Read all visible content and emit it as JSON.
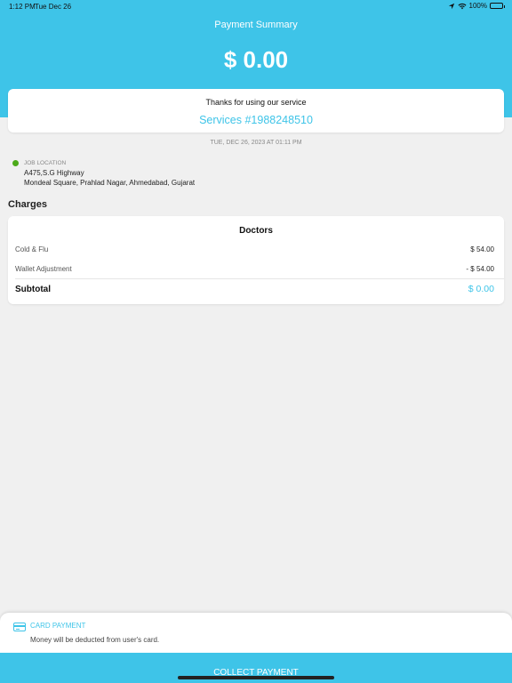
{
  "status_bar": {
    "time": "1:12 PM",
    "date": "Tue Dec 26",
    "battery": "100%"
  },
  "header": {
    "title": "Payment Summary",
    "amount": "$ 0.00"
  },
  "service": {
    "thanks": "Thanks for using our service",
    "id": "Services #1988248510"
  },
  "datetime": "TUE, DEC 26, 2023 AT 01:11 PM",
  "location": {
    "label": "JOB LOCATION",
    "line1": "A475,S.G Highway",
    "line2": "Mondeal Square, Prahlad Nagar, Ahmedabad, Gujarat"
  },
  "charges": {
    "title": "Charges",
    "card_title": "Doctors",
    "items": [
      {
        "label": "Cold & Flu",
        "value": "$ 54.00"
      },
      {
        "label": "Wallet Adjustment",
        "value": "- $ 54.00"
      }
    ],
    "subtotal_label": "Subtotal",
    "subtotal_value": "$ 0.00"
  },
  "payment": {
    "label": "CARD PAYMENT",
    "description": "Money will be deducted from user's card."
  },
  "collect_button": "COLLECT PAYMENT",
  "colors": {
    "accent": "#3ec4e8",
    "location_dot": "#4caa1a"
  },
  "icons": {
    "location": "location-arrow-icon",
    "wifi": "wifi-icon",
    "battery": "battery-icon",
    "card": "credit-card-icon"
  }
}
